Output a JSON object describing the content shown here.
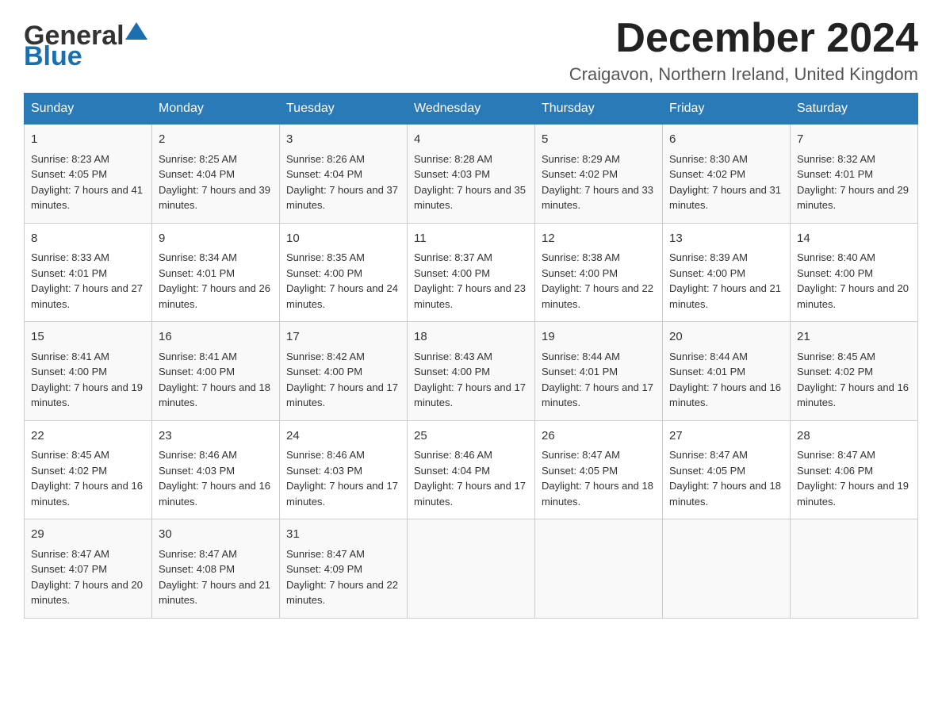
{
  "header": {
    "logo_general": "General",
    "logo_blue": "Blue",
    "month_title": "December 2024",
    "location": "Craigavon, Northern Ireland, United Kingdom"
  },
  "days_of_week": [
    "Sunday",
    "Monday",
    "Tuesday",
    "Wednesday",
    "Thursday",
    "Friday",
    "Saturday"
  ],
  "weeks": [
    [
      {
        "day": "1",
        "sunrise": "8:23 AM",
        "sunset": "4:05 PM",
        "daylight": "7 hours and 41 minutes."
      },
      {
        "day": "2",
        "sunrise": "8:25 AM",
        "sunset": "4:04 PM",
        "daylight": "7 hours and 39 minutes."
      },
      {
        "day": "3",
        "sunrise": "8:26 AM",
        "sunset": "4:04 PM",
        "daylight": "7 hours and 37 minutes."
      },
      {
        "day": "4",
        "sunrise": "8:28 AM",
        "sunset": "4:03 PM",
        "daylight": "7 hours and 35 minutes."
      },
      {
        "day": "5",
        "sunrise": "8:29 AM",
        "sunset": "4:02 PM",
        "daylight": "7 hours and 33 minutes."
      },
      {
        "day": "6",
        "sunrise": "8:30 AM",
        "sunset": "4:02 PM",
        "daylight": "7 hours and 31 minutes."
      },
      {
        "day": "7",
        "sunrise": "8:32 AM",
        "sunset": "4:01 PM",
        "daylight": "7 hours and 29 minutes."
      }
    ],
    [
      {
        "day": "8",
        "sunrise": "8:33 AM",
        "sunset": "4:01 PM",
        "daylight": "7 hours and 27 minutes."
      },
      {
        "day": "9",
        "sunrise": "8:34 AM",
        "sunset": "4:01 PM",
        "daylight": "7 hours and 26 minutes."
      },
      {
        "day": "10",
        "sunrise": "8:35 AM",
        "sunset": "4:00 PM",
        "daylight": "7 hours and 24 minutes."
      },
      {
        "day": "11",
        "sunrise": "8:37 AM",
        "sunset": "4:00 PM",
        "daylight": "7 hours and 23 minutes."
      },
      {
        "day": "12",
        "sunrise": "8:38 AM",
        "sunset": "4:00 PM",
        "daylight": "7 hours and 22 minutes."
      },
      {
        "day": "13",
        "sunrise": "8:39 AM",
        "sunset": "4:00 PM",
        "daylight": "7 hours and 21 minutes."
      },
      {
        "day": "14",
        "sunrise": "8:40 AM",
        "sunset": "4:00 PM",
        "daylight": "7 hours and 20 minutes."
      }
    ],
    [
      {
        "day": "15",
        "sunrise": "8:41 AM",
        "sunset": "4:00 PM",
        "daylight": "7 hours and 19 minutes."
      },
      {
        "day": "16",
        "sunrise": "8:41 AM",
        "sunset": "4:00 PM",
        "daylight": "7 hours and 18 minutes."
      },
      {
        "day": "17",
        "sunrise": "8:42 AM",
        "sunset": "4:00 PM",
        "daylight": "7 hours and 17 minutes."
      },
      {
        "day": "18",
        "sunrise": "8:43 AM",
        "sunset": "4:00 PM",
        "daylight": "7 hours and 17 minutes."
      },
      {
        "day": "19",
        "sunrise": "8:44 AM",
        "sunset": "4:01 PM",
        "daylight": "7 hours and 17 minutes."
      },
      {
        "day": "20",
        "sunrise": "8:44 AM",
        "sunset": "4:01 PM",
        "daylight": "7 hours and 16 minutes."
      },
      {
        "day": "21",
        "sunrise": "8:45 AM",
        "sunset": "4:02 PM",
        "daylight": "7 hours and 16 minutes."
      }
    ],
    [
      {
        "day": "22",
        "sunrise": "8:45 AM",
        "sunset": "4:02 PM",
        "daylight": "7 hours and 16 minutes."
      },
      {
        "day": "23",
        "sunrise": "8:46 AM",
        "sunset": "4:03 PM",
        "daylight": "7 hours and 16 minutes."
      },
      {
        "day": "24",
        "sunrise": "8:46 AM",
        "sunset": "4:03 PM",
        "daylight": "7 hours and 17 minutes."
      },
      {
        "day": "25",
        "sunrise": "8:46 AM",
        "sunset": "4:04 PM",
        "daylight": "7 hours and 17 minutes."
      },
      {
        "day": "26",
        "sunrise": "8:47 AM",
        "sunset": "4:05 PM",
        "daylight": "7 hours and 18 minutes."
      },
      {
        "day": "27",
        "sunrise": "8:47 AM",
        "sunset": "4:05 PM",
        "daylight": "7 hours and 18 minutes."
      },
      {
        "day": "28",
        "sunrise": "8:47 AM",
        "sunset": "4:06 PM",
        "daylight": "7 hours and 19 minutes."
      }
    ],
    [
      {
        "day": "29",
        "sunrise": "8:47 AM",
        "sunset": "4:07 PM",
        "daylight": "7 hours and 20 minutes."
      },
      {
        "day": "30",
        "sunrise": "8:47 AM",
        "sunset": "4:08 PM",
        "daylight": "7 hours and 21 minutes."
      },
      {
        "day": "31",
        "sunrise": "8:47 AM",
        "sunset": "4:09 PM",
        "daylight": "7 hours and 22 minutes."
      },
      null,
      null,
      null,
      null
    ]
  ],
  "labels": {
    "sunrise": "Sunrise:",
    "sunset": "Sunset:",
    "daylight": "Daylight:"
  }
}
